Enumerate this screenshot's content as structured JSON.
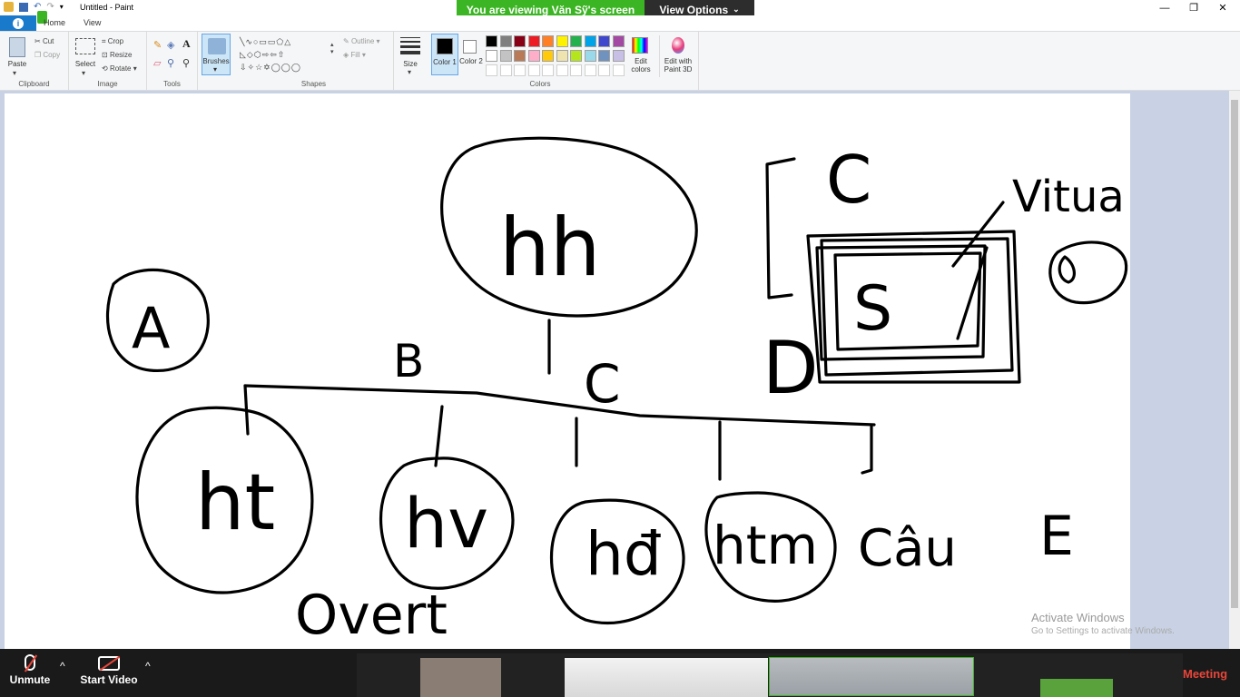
{
  "window": {
    "title": "Untitled - Paint"
  },
  "share_banner": {
    "viewing_text": "You are viewing Văn Sỹ's screen",
    "view_options_label": "View Options"
  },
  "tabs": [
    {
      "label": "Home"
    },
    {
      "label": "View"
    }
  ],
  "ribbon": {
    "clipboard": {
      "paste": "Paste",
      "cut": "Cut",
      "copy": "Copy",
      "label": "Clipboard"
    },
    "image": {
      "select": "Select",
      "crop": "Crop",
      "resize": "Resize",
      "rotate": "Rotate",
      "label": "Image"
    },
    "tools": {
      "label": "Tools"
    },
    "brushes": {
      "label": "Brushes"
    },
    "shapes": {
      "outline": "Outline",
      "fill": "Fill",
      "label": "Shapes"
    },
    "size": {
      "label": "Size"
    },
    "colors": {
      "color1": "Color 1",
      "color2": "Color 2",
      "edit": "Edit colors",
      "paint3d": "Edit with Paint 3D",
      "label": "Colors",
      "palette_row1": [
        "#000000",
        "#7f7f7f",
        "#880015",
        "#ed1c24",
        "#ff7f27",
        "#fff200",
        "#22b14c",
        "#00a2e8",
        "#3f48cc",
        "#a349a4"
      ],
      "palette_row2": [
        "#ffffff",
        "#c3c3c3",
        "#b97a57",
        "#ffaec9",
        "#ffc90e",
        "#efe4b0",
        "#b5e61d",
        "#99d9ea",
        "#7092be",
        "#c8bfe7"
      ]
    }
  },
  "drawing": {
    "texts": [
      "hh",
      "A",
      "B",
      "C",
      "C",
      "D",
      "S",
      "Vitua",
      "ht",
      "hv",
      "hđ",
      "htm",
      "Câu",
      "E",
      "Overt"
    ]
  },
  "watermark": {
    "title": "Activate Windows",
    "subtitle": "Go to Settings to activate Windows."
  },
  "zoom_toolbar": {
    "unmute": "Unmute",
    "start_video": "Start Video",
    "meeting": "Meeting"
  }
}
